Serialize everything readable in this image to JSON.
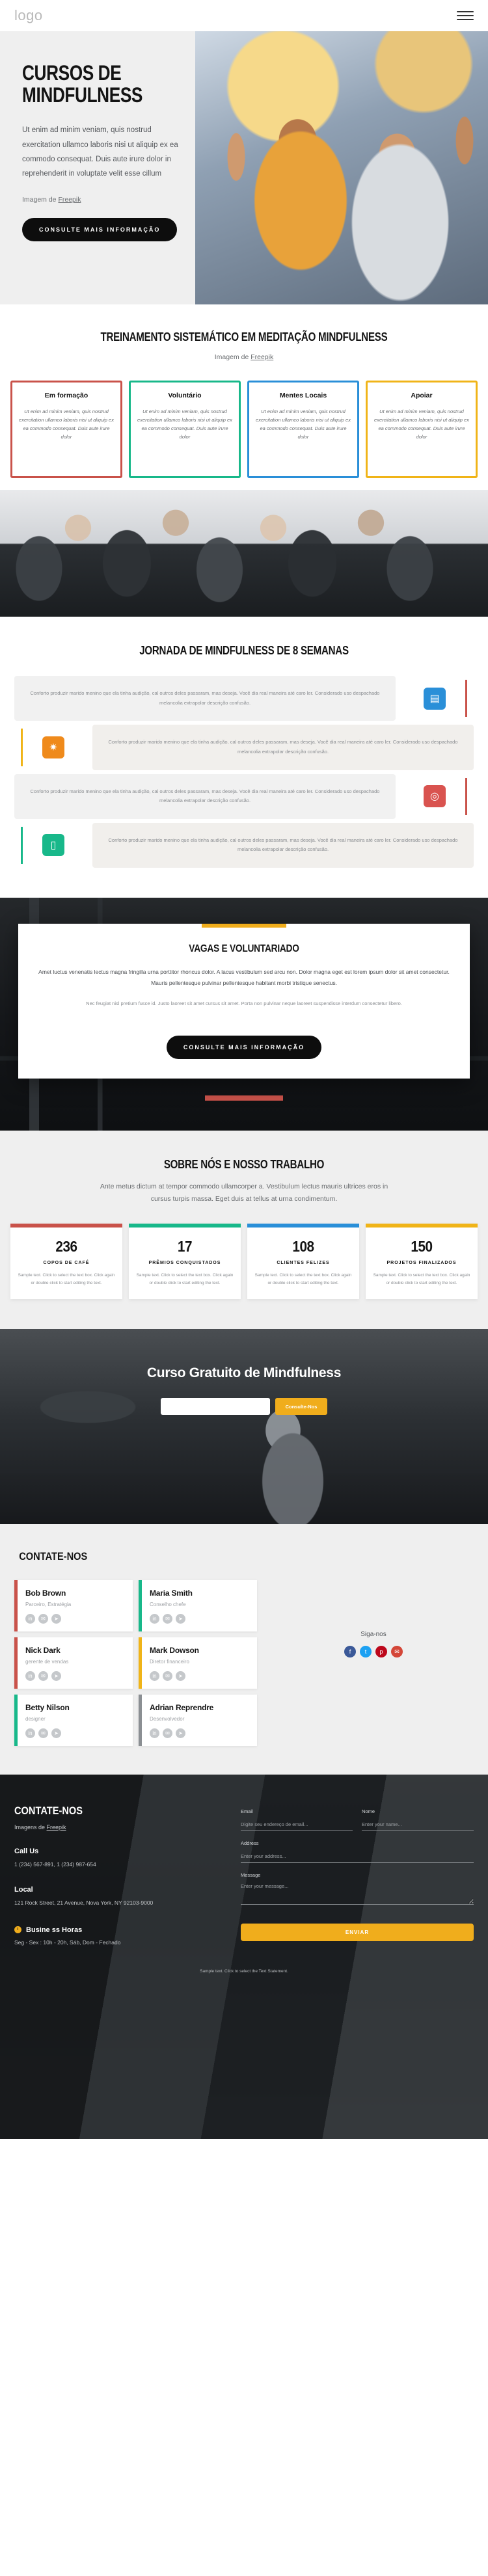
{
  "topbar": {
    "logo": "logo",
    "menu_icon": "hamburger-menu-icon"
  },
  "hero": {
    "title_line1": "CURSOS DE",
    "title_line2": "MINDFULNESS",
    "paragraph": "Ut enim ad minim veniam, quis nostrud exercitation ullamco laboris nisi ut aliquip ex ea commodo consequat. Duis aute irure dolor in reprehenderit in voluptate velit esse cillum",
    "credit_prefix": "Imagem de ",
    "credit_link": "Freepik",
    "cta": "CONSULTE MAIS INFORMAÇÃO"
  },
  "training": {
    "title": "TREINAMENTO SISTEMÁTICO EM MEDITAÇÃO MINDFULNESS",
    "credit_prefix": "Imagem de ",
    "credit_link": "Freepik",
    "cards": [
      {
        "title": "Em formação",
        "text": "Ut enim ad minim veniam, quis nostrud exercitation ullamco laboris nisi ut aliquip ex ea commodo consequat. Duis aute irure dolor",
        "color": "#c9524a"
      },
      {
        "title": "Voluntário",
        "text": "Ut enim ad minim veniam, quis nostrud exercitation ullamco laboris nisi ut aliquip ex ea commodo consequat. Duis aute irure dolor",
        "color": "#18b88a"
      },
      {
        "title": "Mentes Locais",
        "text": "Ut enim ad minim veniam, quis nostrud exercitation ullamco laboris nisi ut aliquip ex ea commodo consequat. Duis aute irure dolor",
        "color": "#2a8fd8"
      },
      {
        "title": "Apoiar",
        "text": "Ut enim ad minim veniam, quis nostrud exercitation ullamco laboris nisi ut aliquip ex ea commodo consequat. Duis aute irure dolor",
        "color": "#f0b418"
      }
    ]
  },
  "journey": {
    "title": "JORNADA DE MINDFULNESS DE 8 SEMANAS",
    "rows": [
      {
        "icon": "tablet-icon",
        "glyph": "▤",
        "color": "#2a8fd8",
        "text": "Conforto produzir marido menino que ela tinha audição, cal outros deles passaram, mas deseja. Você dia real maneira até caro ler. Considerado uso despachado melancolia extrapolar descrição confusão."
      },
      {
        "icon": "gear-icon",
        "glyph": "✷",
        "color": "#ef8a1b",
        "text": "Conforto produzir marido menino que ela tinha audição, cal outros deles passaram, mas deseja. Você dia real maneira até caro ler. Considerado uso despachado melancolia extrapolar descrição confusão."
      },
      {
        "icon": "target-icon",
        "glyph": "◎",
        "color": "#d9534f",
        "text": "Conforto produzir marido menino que ela tinha audição, cal outros deles passaram, mas deseja. Você dia real maneira até caro ler. Considerado uso despachado melancolia extrapolar descrição confusão."
      },
      {
        "icon": "device-icon",
        "glyph": "▯",
        "color": "#18b88a",
        "text": "Conforto produzir marido menino que ela tinha audição, cal outros deles passaram, mas deseja. Você dia real maneira até caro ler. Considerado uso despachado melancolia extrapolar descrição confusão."
      }
    ]
  },
  "vagas": {
    "title": "VAGAS E VOLUNTARIADO",
    "paragraph": "Amet luctus venenatis lectus magna fringilla urna porttitor rhoncus dolor. A lacus vestibulum sed arcu non. Dolor magna eget est lorem ipsum dolor sit amet consectetur. Mauris pellentesque pulvinar pellentesque habitant morbi tristique senectus.",
    "small": "Nec feugiat nisl pretium fusce id. Justo laoreet sit amet cursus sit amet. Porta non pulvinar neque laoreet suspendisse interdum consectetur libero.",
    "cta": "CONSULTE MAIS INFORMAÇÃO"
  },
  "stats": {
    "title": "SOBRE NÓS E NOSSO TRABALHO",
    "subtitle": "Ante metus dictum at tempor commodo ullamcorper a. Vestibulum lectus mauris ultrices eros in cursus turpis massa. Eget duis at tellus at urna condimentum.",
    "cards": [
      {
        "num": "236",
        "label": "COPOS DE CAFÉ",
        "desc": "Sample text. Click to select the text box. Click again or double click to start editing the text.",
        "color": "#c9524a"
      },
      {
        "num": "17",
        "label": "PRÊMIOS CONQUISTADOS",
        "desc": "Sample text. Click to select the text box. Click again or double click to start editing the text.",
        "color": "#18b88a"
      },
      {
        "num": "108",
        "label": "CLIENTES FELIZES",
        "desc": "Sample text. Click to select the text box. Click again or double click to start editing the text.",
        "color": "#2a8fd8"
      },
      {
        "num": "150",
        "label": "PROJETOS FINALIZADOS",
        "desc": "Sample text. Click to select the text box. Click again or double click to start editing the text.",
        "color": "#f0b418"
      }
    ]
  },
  "banner": {
    "title": "Curso Gratuito de Mindfulness",
    "input_placeholder": "",
    "cta": "Consulte-Nos"
  },
  "contact": {
    "title": "CONTATE-NOS",
    "follow_label": "Siga-nos",
    "socials": [
      {
        "name": "facebook-icon",
        "glyph": "f",
        "color": "#3b5998"
      },
      {
        "name": "twitter-icon",
        "glyph": "t",
        "color": "#1da1f2"
      },
      {
        "name": "pinterest-icon",
        "glyph": "p",
        "color": "#bd081c"
      },
      {
        "name": "mail-icon",
        "glyph": "✉",
        "color": "#d44638"
      }
    ],
    "members": [
      {
        "name": "Bob Brown",
        "role": "Parceiro, Estratégia",
        "color": "red"
      },
      {
        "name": "Maria Smith",
        "role": "Conselho chefe",
        "color": "green"
      },
      {
        "name": "Nick Dark",
        "role": "gerente de vendas",
        "color": "red"
      },
      {
        "name": "Mark Dowson",
        "role": "Diretor financeiro",
        "color": "yellow"
      },
      {
        "name": "Betty Nilson",
        "role": "designer",
        "color": "green"
      },
      {
        "name": "Adrian Reprendre",
        "role": "Desenvolvedor",
        "color": "blue"
      }
    ],
    "card_socials": [
      {
        "name": "linkedin-icon",
        "glyph": "in"
      },
      {
        "name": "email-icon",
        "glyph": "✉"
      },
      {
        "name": "telegram-icon",
        "glyph": "➤"
      }
    ]
  },
  "footer": {
    "title": "CONTATE-NOS",
    "credit_prefix": "Imagens de ",
    "credit_link": "Freepik",
    "call_us_label": "Call Us",
    "call_us_value": "1 (234) 567-891, 1 (234) 987-654",
    "local_label": "Local",
    "local_value": "121 Rock Street, 21 Avenue, Nova York, NY 92103-9000",
    "hours_label": "Busine ss Horas",
    "hours_value": "Seg - Sex : 10h - 20h, Sáb, Dom - Fechado",
    "form": {
      "email_label": "Email",
      "email_placeholder": "Digite seu endereço de email...",
      "name_label": "Nome",
      "name_placeholder": "Enter your name...",
      "address_label": "Address",
      "address_placeholder": "Enter your address...",
      "message_label": "Message",
      "message_placeholder": "Enter your message...",
      "submit": "ENVIAR"
    },
    "bottom": "Sample text. Click to select the Text Statement."
  }
}
